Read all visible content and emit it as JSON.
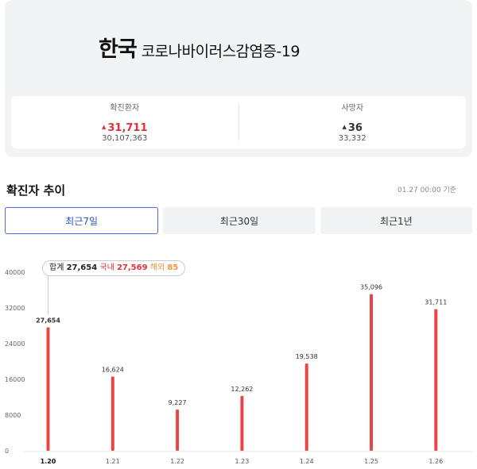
{
  "header": {
    "title_main": "한국",
    "title_sub": "코로나바이러스감염증-19"
  },
  "stats": {
    "confirmed": {
      "label": "확진환자",
      "change": "31,711",
      "total": "30,107,363"
    },
    "deaths": {
      "label": "사망자",
      "change": "36",
      "total": "33,332"
    }
  },
  "trend": {
    "title": "확진자 추이",
    "as_of": "01.27 00:00 기준",
    "tabs": [
      "최근7일",
      "최근30일",
      "최근1년"
    ]
  },
  "tooltip": {
    "total_label": "합계",
    "total_value": "27,654",
    "domestic_label": "국내",
    "domestic_value": "27,569",
    "overseas_label": "해외",
    "overseas_value": "85"
  },
  "colors": {
    "bar": "#e84545",
    "accent_red": "#e0303b",
    "accent_orange": "#f0963c",
    "tab_active": "#4a6bd8"
  },
  "chart_data": {
    "type": "bar",
    "categories": [
      "1.20",
      "1.21",
      "1.22",
      "1.23",
      "1.24",
      "1.25",
      "1.26"
    ],
    "values": [
      27654,
      16624,
      9227,
      12262,
      19538,
      35096,
      31711
    ],
    "value_labels": [
      "27,654",
      "16,624",
      "9,227",
      "12,262",
      "19,538",
      "35,096",
      "31,711"
    ],
    "yticks": [
      "0",
      "8000",
      "16000",
      "24000",
      "32000",
      "40000"
    ],
    "ylim": [
      0,
      40000
    ],
    "selected_index": 0,
    "grid": false
  }
}
